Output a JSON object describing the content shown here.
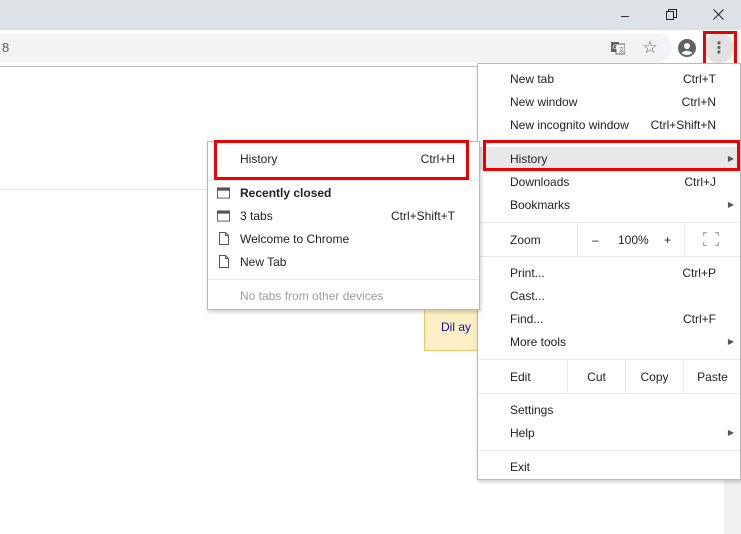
{
  "window": {
    "minimize_icon": "–",
    "restore_icon": "❐",
    "close_icon": "✕"
  },
  "toolbar": {
    "omnibox_text": "8",
    "translate_icon": "translate-icon",
    "star_icon": "☆",
    "profile_icon": "profile-icon",
    "menu_icon": "⋮"
  },
  "tooltip": {
    "text": "Dil ay"
  },
  "main_menu": {
    "items": [
      {
        "label": "New tab",
        "shortcut": "Ctrl+T"
      },
      {
        "label": "New window",
        "shortcut": "Ctrl+N"
      },
      {
        "label": "New incognito window",
        "shortcut": "Ctrl+Shift+N"
      },
      {
        "label": "History",
        "arrow": "▶"
      },
      {
        "label": "Downloads",
        "shortcut": "Ctrl+J"
      },
      {
        "label": "Bookmarks",
        "arrow": "▶"
      },
      {
        "label": "Print...",
        "shortcut": "Ctrl+P"
      },
      {
        "label": "Cast..."
      },
      {
        "label": "Find...",
        "shortcut": "Ctrl+F"
      },
      {
        "label": "More tools",
        "arrow": "▶"
      },
      {
        "label": "Settings"
      },
      {
        "label": "Help",
        "arrow": "▶"
      },
      {
        "label": "Exit"
      }
    ],
    "zoom": {
      "label": "Zoom",
      "minus": "–",
      "value": "100%",
      "plus": "+",
      "fullscreen_icon": "fullscreen-icon"
    },
    "edit": {
      "label": "Edit",
      "cut": "Cut",
      "copy": "Copy",
      "paste": "Paste"
    }
  },
  "history_submenu": {
    "history": {
      "label": "History",
      "shortcut": "Ctrl+H"
    },
    "recently_closed": "Recently closed",
    "items": [
      {
        "label": "3 tabs",
        "shortcut": "Ctrl+Shift+T",
        "icon": "window-icon"
      },
      {
        "label": "Welcome to Chrome",
        "icon": "page-icon"
      },
      {
        "label": "New Tab",
        "icon": "page-icon"
      }
    ],
    "no_tabs": "No tabs from other devices"
  }
}
